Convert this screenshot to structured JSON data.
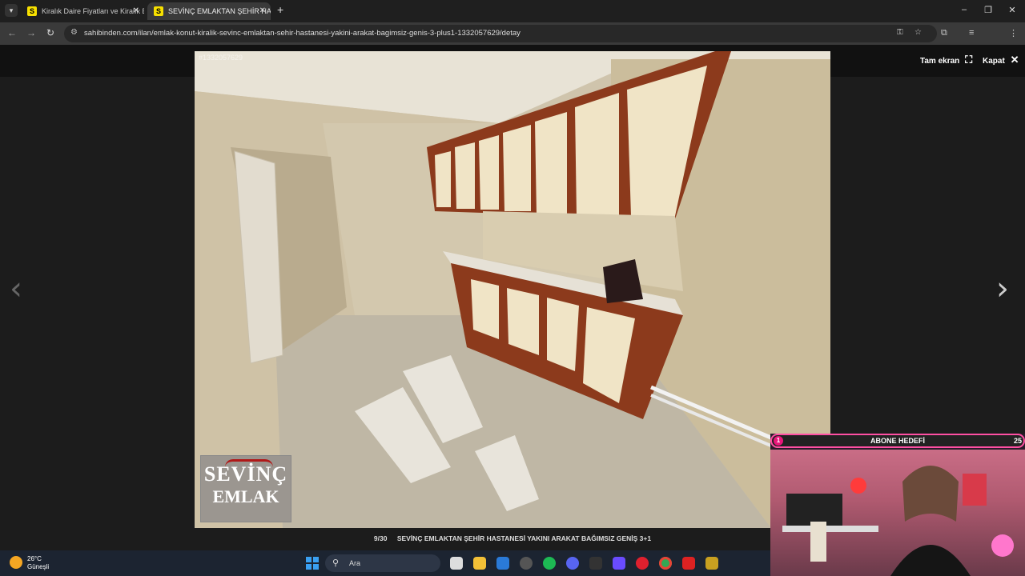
{
  "browser": {
    "tabs": [
      {
        "label": "Kiralık Daire Fiyatları ve Kiralık E",
        "favicon": "S"
      },
      {
        "label": "SEVİNÇ EMLAKTAN ŞEHİR HAS",
        "favicon": "S"
      }
    ],
    "url": "sahibinden.com/ilan/emlak-konut-kiralik-sevinc-emlaktan-sehir-hastanesi-yakini-arakat-bagimsiz-genis-3-plus1-1332057629/detay"
  },
  "viewer": {
    "fullscreen_label": "Tam ekran",
    "close_label": "Kapat",
    "photo_id": "#1332057629",
    "counter": "9/30",
    "caption": "SEVİNÇ EMLAKTAN ŞEHİR HASTANESİ YAKINI ARAKAT BAĞIMSIZ GENİŞ 3+1",
    "logo_line1": "SEVİNÇ",
    "logo_line2": "EMLAK"
  },
  "taskbar": {
    "temperature": "26°C",
    "weather": "Güneşli",
    "search_placeholder": "Ara"
  },
  "stream_overlay": {
    "goal_title": "ABONE HEDEFİ",
    "current": "1",
    "target": "25"
  },
  "colors": {
    "favicon": "#f7e000",
    "goal_border": "#ff4fa3",
    "windows_blue": "#3aa0f2"
  }
}
